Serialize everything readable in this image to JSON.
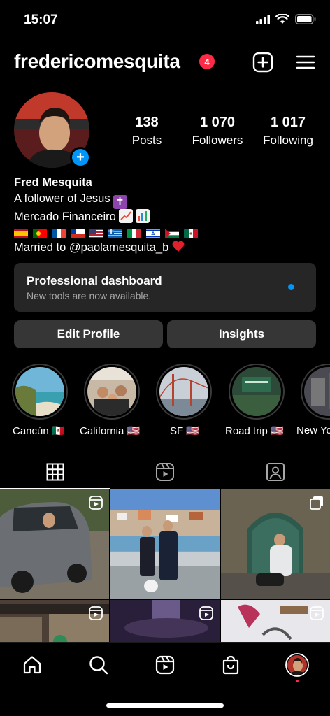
{
  "status_bar": {
    "time": "15:07",
    "icons": [
      "signal-icon",
      "wifi-icon",
      "battery-icon"
    ]
  },
  "header": {
    "username": "fredericomesquita",
    "notification_count": "4",
    "icons": [
      "plus-square-icon",
      "hamburger-menu-icon"
    ]
  },
  "profile": {
    "stats": [
      {
        "value": "138",
        "label": "Posts"
      },
      {
        "value": "1 070",
        "label": "Followers"
      },
      {
        "value": "1 017",
        "label": "Following"
      }
    ],
    "add_story_label": "+"
  },
  "bio": {
    "name": "Fred Mesquita",
    "line1": "A follower of Jesus",
    "line2": "Mercado Financeiro",
    "line4": "Married to @paolamesquita_b",
    "flags": [
      "spain",
      "portugal",
      "france",
      "chile",
      "usa",
      "greece",
      "italy",
      "israel",
      "palestine",
      "mexico"
    ]
  },
  "dashboard": {
    "title": "Professional dashboard",
    "subtitle": "New tools are now available."
  },
  "buttons": {
    "edit_profile": "Edit Profile",
    "insights": "Insights"
  },
  "highlights": [
    {
      "label": "Cancún 🇲🇽"
    },
    {
      "label": "California 🇺🇸"
    },
    {
      "label": "SF 🇺🇸"
    },
    {
      "label": "Road trip 🇺🇸"
    },
    {
      "label": "New Yo"
    }
  ],
  "tabs": [
    "grid-icon",
    "reels-icon",
    "tagged-icon"
  ],
  "bottom_nav": [
    "home-icon",
    "search-icon",
    "reels-icon",
    "shop-icon",
    "profile-avatar"
  ],
  "colors": {
    "accent": "#0095f6",
    "badge": "#ff2a45",
    "surface": "#262626",
    "button": "#363636"
  }
}
